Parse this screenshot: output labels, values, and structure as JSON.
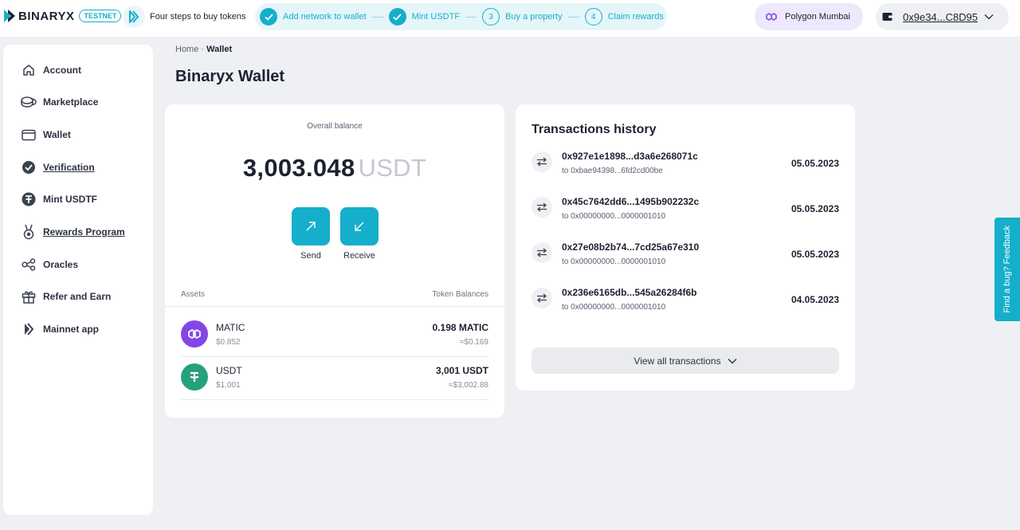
{
  "header": {
    "logo_text": "BINARYX",
    "badge": "TESTNET",
    "steps_intro": "Four steps to buy tokens",
    "steps": [
      {
        "label": "Add network to wallet",
        "status": "done",
        "number": ""
      },
      {
        "label": "Mint USDTF",
        "status": "done",
        "number": ""
      },
      {
        "label": "Buy a property",
        "status": "todo",
        "number": "3"
      },
      {
        "label": "Claim rewards",
        "status": "todo",
        "number": "4"
      }
    ],
    "network": "Polygon Mumbai",
    "wallet_address": "0x9e34...C8D95"
  },
  "sidebar": {
    "items": [
      {
        "label": "Account",
        "icon": "home-icon"
      },
      {
        "label": "Marketplace",
        "icon": "coins-icon"
      },
      {
        "label": "Wallet",
        "icon": "wallet-icon"
      },
      {
        "label": "Verification",
        "icon": "verified-check-icon"
      },
      {
        "label": "Mint USDTF",
        "icon": "tether-icon"
      },
      {
        "label": "Rewards Program",
        "icon": "medal-icon"
      },
      {
        "label": "Oracles",
        "icon": "share-nodes-icon"
      },
      {
        "label": "Refer and Earn",
        "icon": "gift-icon"
      },
      {
        "label": "Mainnet app",
        "icon": "binaryx-logo-icon"
      }
    ]
  },
  "breadcrumb": {
    "home": "Home",
    "separator": "·",
    "current": "Wallet"
  },
  "page_title": "Binaryx Wallet",
  "balance": {
    "label": "Overall balance",
    "amount": "3,003.048",
    "unit": "USDT",
    "send_label": "Send",
    "receive_label": "Receive"
  },
  "assets": {
    "header_left": "Assets",
    "header_right": "Token Balances",
    "rows": [
      {
        "name": "MATIC",
        "price": "$0.852",
        "amount": "0.198 MATIC",
        "usd": "≈$0.169",
        "icon": "polygon-icon",
        "color": "#8247e5"
      },
      {
        "name": "USDT",
        "price": "$1.001",
        "amount": "3,001 USDT",
        "usd": "≈$3,002.88",
        "icon": "tether-icon",
        "color": "#26a17b"
      }
    ]
  },
  "transactions": {
    "title": "Transactions history",
    "to_prefix": "to",
    "rows": [
      {
        "hash": "0x927e1e1898...d3a6e268071c",
        "to": "0xbae94398...6fd2cd00be",
        "date": "05.05.2023"
      },
      {
        "hash": "0x45c7642dd6...1495b902232c",
        "to": "0x00000000...0000001010",
        "date": "05.05.2023"
      },
      {
        "hash": "0x27e08b2b74...7cd25a67e310",
        "to": "0x00000000...0000001010",
        "date": "05.05.2023"
      },
      {
        "hash": "0x236e6165db...545a26284f6b",
        "to": "0x00000000...0000001010",
        "date": "04.05.2023"
      }
    ],
    "view_all": "View all transactions"
  },
  "feedback": "Find a bug? Feedback",
  "colors": {
    "accent": "#15aecb",
    "matic": "#8247e5",
    "usdt": "#26a17b"
  }
}
